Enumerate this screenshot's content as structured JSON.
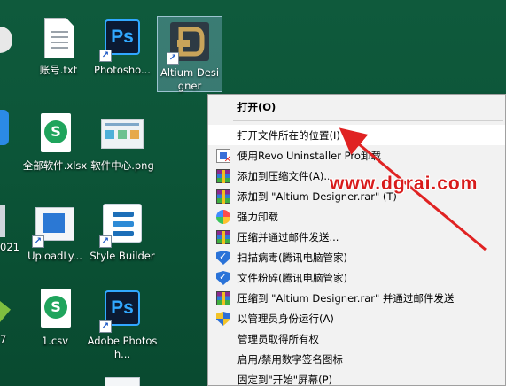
{
  "desktop": {
    "icons": [
      {
        "label": "账号.txt",
        "icon": "text-file-icon"
      },
      {
        "label": "Photosho...",
        "icon": "photoshop-icon"
      },
      {
        "label": "Altium Designer",
        "icon": "altium-designer-icon"
      },
      {
        "label": "全部软件.xlsx",
        "icon": "spreadsheet-icon"
      },
      {
        "label": "软件中心.png",
        "icon": "image-file-icon"
      },
      {
        "label": "UploadLy...",
        "icon": "uploadly-icon"
      },
      {
        "label": "Style Builder",
        "icon": "style-builder-icon"
      },
      {
        "label": "1.csv",
        "icon": "csv-file-icon"
      },
      {
        "label": "Adobe Photosh...",
        "icon": "photoshop-icon"
      }
    ],
    "edge_labels": [
      "021",
      "7"
    ]
  },
  "context_menu": {
    "items": [
      {
        "label": "打开(O)",
        "bold": true
      },
      {
        "label": "打开文件所在的位置(I)",
        "highlighted": true
      },
      {
        "label": "使用Revo Uninstaller Pro卸载",
        "icon": "revo-uninstaller-icon"
      },
      {
        "label": "添加到压缩文件(A)...",
        "icon": "winrar-icon"
      },
      {
        "label": "添加到 \"Altium Designer.rar\" (T)",
        "icon": "winrar-icon"
      },
      {
        "label": "强力卸载",
        "icon": "pinwheel-icon"
      },
      {
        "label": "压缩并通过邮件发送...",
        "icon": "winrar-icon"
      },
      {
        "label": "扫描病毒(腾讯电脑管家)",
        "icon": "shield-icon"
      },
      {
        "label": "文件粉碎(腾讯电脑管家)",
        "icon": "shield-icon"
      },
      {
        "label": "压缩到 \"Altium Designer.rar\" 并通过邮件发送",
        "icon": "winrar-icon"
      },
      {
        "label": "以管理员身份运行(A)",
        "icon": "uac-shield-icon"
      },
      {
        "label": "管理员取得所有权"
      },
      {
        "label": "启用/禁用数字签名图标"
      },
      {
        "label": "固定到\"开始\"屏幕(P)"
      }
    ]
  },
  "watermark": {
    "text": "www.dgrai.com",
    "color": "#d81b1b"
  },
  "colors": {
    "desktop_bg": "#0c5538",
    "menu_bg": "#f2f2f2",
    "ps_blue": "#31a8ff"
  }
}
